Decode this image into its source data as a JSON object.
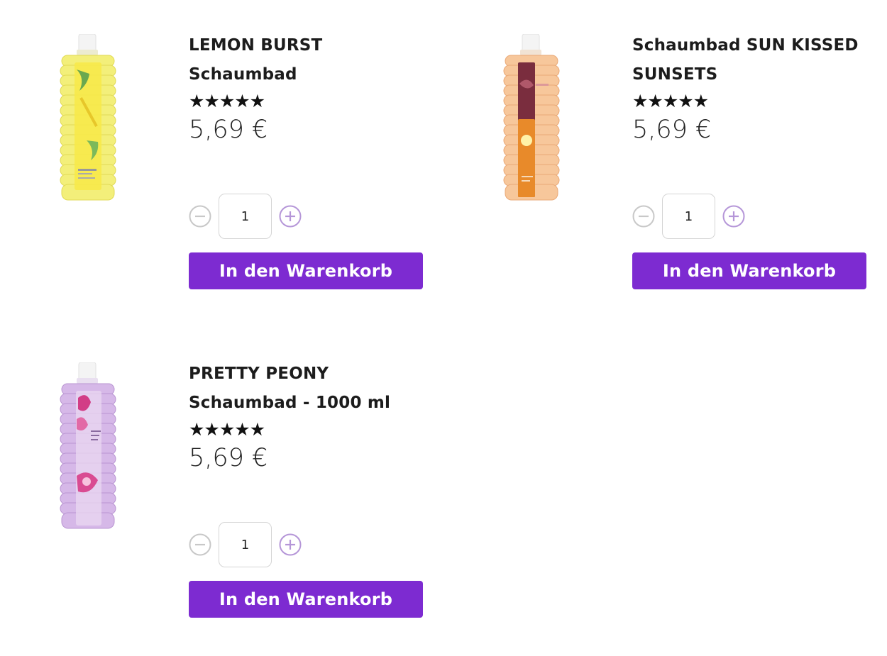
{
  "colors": {
    "accent": "#7d2bd1",
    "button_text": "#ffffff",
    "stars": "#111111",
    "qty_border": "#d5d5d5",
    "qty_icon_minus": "#c8c8c8",
    "qty_icon_plus": "#b596d8"
  },
  "icons": {
    "minus": "minus-circle-icon",
    "plus": "plus-circle-icon",
    "star": "star-icon"
  },
  "products": [
    {
      "name_line1": "LEMON BURST",
      "name_line2": "Schaumbad",
      "rating": 5,
      "stars": "★★★★★",
      "price": "5,69 €",
      "quantity": "1",
      "cart_label": "In den Warenkorb",
      "bottle_color": "#f3ef7a"
    },
    {
      "name_line1": "Schaumbad SUN KISSED",
      "name_line2": "SUNSETS",
      "rating": 5,
      "stars": "★★★★★",
      "price": "5,69 €",
      "quantity": "1",
      "cart_label": "In den Warenkorb",
      "bottle_color": "#f7c79b"
    },
    {
      "name_line1": "PRETTY PEONY",
      "name_line2": "Schaumbad - 1000 ml",
      "rating": 5,
      "stars": "★★★★★",
      "price": "5,69 €",
      "quantity": "1",
      "cart_label": "In den Warenkorb",
      "bottle_color": "#d6b8e8"
    }
  ]
}
